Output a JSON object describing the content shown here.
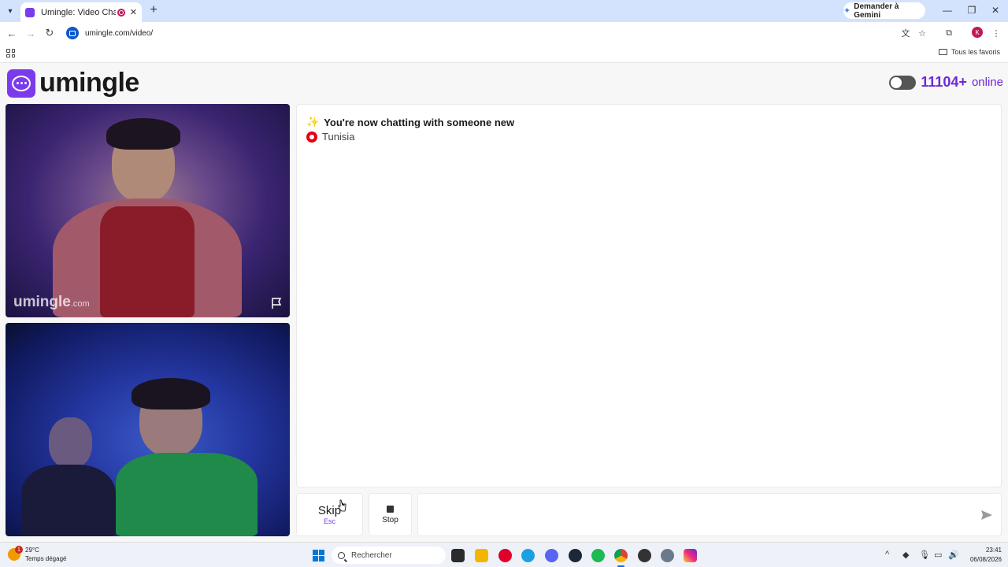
{
  "browser": {
    "tab_title": "Umingle: Video Chat with S",
    "gemini_label": "Demander à Gemini",
    "url": "umingle.com/video/",
    "profile_initial": "K",
    "all_bookmarks": "Tous les favoris"
  },
  "header": {
    "logo_text": "umingle",
    "online_count": "11104+",
    "online_label": "online"
  },
  "videos": {
    "watermark": "umingle",
    "watermark_suffix": ".com"
  },
  "chat": {
    "status_emoji": "✨",
    "status_text": "You're now chatting with someone new",
    "country": "Tunisia"
  },
  "controls": {
    "skip_label": "Skip",
    "skip_key": "Esc",
    "stop_label": "Stop",
    "message_placeholder": ""
  },
  "taskbar": {
    "temperature": "29°C",
    "weather": "Temps dégagé",
    "weather_alert": "1",
    "search_label": "Rechercher",
    "time": "23:41",
    "date": "06/08/2026"
  },
  "colors": {
    "brand": "#7c3aed",
    "online_text": "#6d28d9"
  }
}
